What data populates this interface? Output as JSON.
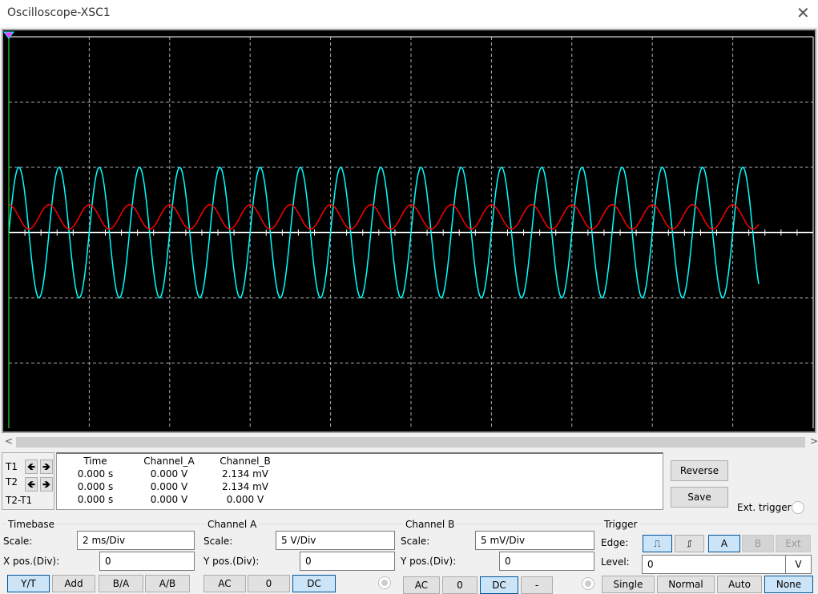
{
  "window": {
    "title": "Oscilloscope-XSC1",
    "close_icon": "close-icon"
  },
  "colors": {
    "channel_a_trace": "#00ffff",
    "channel_b_trace": "#ff0000",
    "screen": "#000000",
    "selected": "#cce4f7"
  },
  "chart_data": {
    "type": "line",
    "x_unit": "ms",
    "x_per_div": 2,
    "x_divs": 10,
    "xlim": [
      0,
      20
    ],
    "y_divs": 6,
    "grid": true,
    "series": [
      {
        "channel": "A",
        "color": "#00ffff",
        "volts_per_div": 5,
        "unit": "V",
        "waveform": "sine",
        "amplitude": 5,
        "offset": 0,
        "frequency_hz": 1000,
        "phase_deg": 0,
        "t_end_ms": 18.65
      },
      {
        "channel": "B",
        "color": "#ff0000",
        "volts_per_div": 5,
        "unit": "mV",
        "waveform": "sine",
        "amplitude": 0.93,
        "offset": 1.2,
        "frequency_hz": 1000,
        "phase_deg": 90,
        "t_end_ms": 18.65
      }
    ]
  },
  "cursors": {
    "t1": "T1",
    "t2": "T2",
    "diff": "T2-T1"
  },
  "readout": {
    "headers": [
      "Time",
      "Channel_A",
      "Channel_B"
    ],
    "rows": [
      [
        "0.000 s",
        "0.000 V",
        "2.134 mV"
      ],
      [
        "0.000 s",
        "0.000 V",
        "2.134 mV"
      ],
      [
        "0.000 s",
        "0.000 V",
        "0.000 V"
      ]
    ]
  },
  "buttons": {
    "reverse": "Reverse",
    "save": "Save",
    "ext_trigger": "Ext. trigger"
  },
  "timebase": {
    "title": "Timebase",
    "scale_label": "Scale:",
    "scale": "2 ms/Div",
    "xpos_label": "X pos.(Div):",
    "xpos": "0",
    "modes": [
      "Y/T",
      "Add",
      "B/A",
      "A/B"
    ],
    "selected": "Y/T"
  },
  "channel_a": {
    "title": "Channel A",
    "scale_label": "Scale:",
    "scale": "5  V/Div",
    "ypos_label": "Y pos.(Div):",
    "ypos": "0",
    "coupling": [
      "AC",
      "0",
      "DC"
    ],
    "selected": "DC"
  },
  "channel_b": {
    "title": "Channel B",
    "scale_label": "Scale:",
    "scale": "5 mV/Div",
    "ypos_label": "Y pos.(Div):",
    "ypos": "0",
    "coupling": [
      "AC",
      "0",
      "DC",
      "-"
    ],
    "selected": "DC"
  },
  "trigger": {
    "title": "Trigger",
    "edge_label": "Edge:",
    "sources": [
      "A",
      "B",
      "Ext"
    ],
    "selected_source": "A",
    "level_label": "Level:",
    "level": "0",
    "level_unit": "V",
    "modes": [
      "Single",
      "Normal",
      "Auto",
      "None"
    ],
    "selected_mode": "None"
  }
}
